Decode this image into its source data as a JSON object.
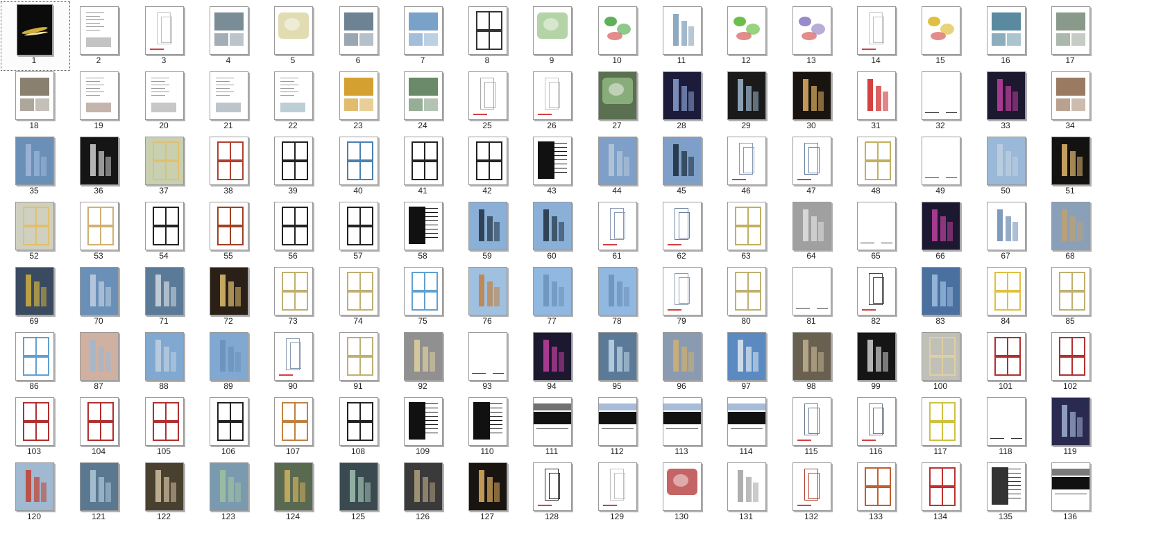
{
  "window": {
    "title": ""
  },
  "pages": [
    {
      "n": "1",
      "kind": "cover",
      "bg": "#0b0b0b",
      "accent": "#e8c040",
      "selected": true
    },
    {
      "n": "2",
      "kind": "text",
      "bg": "#ffffff"
    },
    {
      "n": "3",
      "kind": "sketch",
      "bg": "#ffffff",
      "accent": "#bfbfbf"
    },
    {
      "n": "4",
      "kind": "photo",
      "bg": "#ffffff",
      "accent": "#7a8c96"
    },
    {
      "n": "5",
      "kind": "map",
      "bg": "#ffffff",
      "accent": "#d8d09a"
    },
    {
      "n": "6",
      "kind": "photo",
      "bg": "#ffffff",
      "accent": "#6d8293"
    },
    {
      "n": "7",
      "kind": "photo",
      "bg": "#ffffff",
      "accent": "#7aa2c8"
    },
    {
      "n": "8",
      "kind": "plan",
      "bg": "#ffffff",
      "accent": "#333333"
    },
    {
      "n": "9",
      "kind": "map",
      "bg": "#ffffff",
      "accent": "#9bc48a"
    },
    {
      "n": "10",
      "kind": "diagram",
      "bg": "#ffffff",
      "accent": "#5fb05a"
    },
    {
      "n": "11",
      "kind": "render",
      "bg": "#ffffff",
      "accent": "#7a9ab5"
    },
    {
      "n": "12",
      "kind": "diagram",
      "bg": "#ffffff",
      "accent": "#6cc04a"
    },
    {
      "n": "13",
      "kind": "diagram",
      "bg": "#ffffff",
      "accent": "#9a8ac8"
    },
    {
      "n": "14",
      "kind": "sketch",
      "bg": "#ffffff",
      "accent": "#bfbfbf"
    },
    {
      "n": "15",
      "kind": "diagram",
      "bg": "#ffffff",
      "accent": "#e0c040"
    },
    {
      "n": "16",
      "kind": "photo",
      "bg": "#ffffff",
      "accent": "#5a8aa0"
    },
    {
      "n": "17",
      "kind": "photo",
      "bg": "#ffffff",
      "accent": "#8a9a8a"
    },
    {
      "n": "18",
      "kind": "photo",
      "bg": "#ffffff",
      "accent": "#8a8070"
    },
    {
      "n": "19",
      "kind": "text",
      "bg": "#ffffff",
      "accent": "#8a6a5a"
    },
    {
      "n": "20",
      "kind": "text",
      "bg": "#ffffff",
      "accent": "#909090"
    },
    {
      "n": "21",
      "kind": "text",
      "bg": "#ffffff",
      "accent": "#7a8a9a"
    },
    {
      "n": "22",
      "kind": "text",
      "bg": "#ffffff",
      "accent": "#7aa0b0"
    },
    {
      "n": "23",
      "kind": "photo",
      "bg": "#ffffff",
      "accent": "#d4a030"
    },
    {
      "n": "24",
      "kind": "photo",
      "bg": "#ffffff",
      "accent": "#6a8a6a"
    },
    {
      "n": "25",
      "kind": "sketch",
      "bg": "#ffffff",
      "accent": "#aaaaaa"
    },
    {
      "n": "26",
      "kind": "sketch",
      "bg": "#ffffff",
      "accent": "#bfbfbf"
    },
    {
      "n": "27",
      "kind": "map",
      "bg": "#5a7050",
      "accent": "#9ac08a"
    },
    {
      "n": "28",
      "kind": "render",
      "bg": "#1c1c3a",
      "accent": "#8aa0d0"
    },
    {
      "n": "29",
      "kind": "render",
      "bg": "#1a1a1a",
      "accent": "#a0b8d0"
    },
    {
      "n": "30",
      "kind": "render",
      "bg": "#1a1410",
      "accent": "#e0b060"
    },
    {
      "n": "31",
      "kind": "render",
      "bg": "#ffffff",
      "accent": "#cc2020"
    },
    {
      "n": "32",
      "kind": "blank",
      "bg": "#ffffff"
    },
    {
      "n": "33",
      "kind": "render",
      "bg": "#1c1830",
      "accent": "#c040a0"
    },
    {
      "n": "34",
      "kind": "photo",
      "bg": "#ffffff",
      "accent": "#9a7a60"
    },
    {
      "n": "35",
      "kind": "render",
      "bg": "#6a90b8",
      "accent": "#a0b8d8"
    },
    {
      "n": "36",
      "kind": "render",
      "bg": "#151515",
      "accent": "#d0d0d0"
    },
    {
      "n": "37",
      "kind": "plan",
      "bg": "#c8d0b0",
      "accent": "#e0c070"
    },
    {
      "n": "38",
      "kind": "plan",
      "bg": "#ffffff",
      "accent": "#b04030"
    },
    {
      "n": "39",
      "kind": "plan",
      "bg": "#ffffff",
      "accent": "#222222"
    },
    {
      "n": "40",
      "kind": "plan",
      "bg": "#ffffff",
      "accent": "#4a80b0"
    },
    {
      "n": "41",
      "kind": "plan",
      "bg": "#ffffff",
      "accent": "#222222"
    },
    {
      "n": "42",
      "kind": "plan",
      "bg": "#ffffff",
      "accent": "#222222"
    },
    {
      "n": "43",
      "kind": "section",
      "bg": "#ffffff",
      "accent": "#111111"
    },
    {
      "n": "44",
      "kind": "render",
      "bg": "#7ea0c8",
      "accent": "#b8c8d8"
    },
    {
      "n": "45",
      "kind": "render",
      "bg": "#7ea0c8",
      "accent": "#1a2a3a"
    },
    {
      "n": "46",
      "kind": "sketch",
      "bg": "#ffffff",
      "accent": "#8a9ab0"
    },
    {
      "n": "47",
      "kind": "sketch",
      "bg": "#ffffff",
      "accent": "#6a80a0"
    },
    {
      "n": "48",
      "kind": "plan",
      "bg": "#ffffff",
      "accent": "#c0b060"
    },
    {
      "n": "49",
      "kind": "blank",
      "bg": "#ffffff"
    },
    {
      "n": "50",
      "kind": "render",
      "bg": "#9ab8d8",
      "accent": "#c0d0e0"
    },
    {
      "n": "51",
      "kind": "render",
      "bg": "#141210",
      "accent": "#e0b870"
    },
    {
      "n": "52",
      "kind": "plan",
      "bg": "#d0d0c0",
      "accent": "#e0c070"
    },
    {
      "n": "53",
      "kind": "plan",
      "bg": "#ffffff",
      "accent": "#d0b070"
    },
    {
      "n": "54",
      "kind": "plan",
      "bg": "#ffffff",
      "accent": "#222222"
    },
    {
      "n": "55",
      "kind": "plan",
      "bg": "#ffffff",
      "accent": "#a04020"
    },
    {
      "n": "56",
      "kind": "plan",
      "bg": "#ffffff",
      "accent": "#222222"
    },
    {
      "n": "57",
      "kind": "plan",
      "bg": "#ffffff",
      "accent": "#222222"
    },
    {
      "n": "58",
      "kind": "section",
      "bg": "#ffffff",
      "accent": "#111111"
    },
    {
      "n": "59",
      "kind": "render",
      "bg": "#8ab0d8",
      "accent": "#203040"
    },
    {
      "n": "60",
      "kind": "render",
      "bg": "#8ab0d8",
      "accent": "#203040"
    },
    {
      "n": "61",
      "kind": "sketch",
      "bg": "#ffffff",
      "accent": "#8a9ab0"
    },
    {
      "n": "62",
      "kind": "sketch",
      "bg": "#ffffff",
      "accent": "#6a80a0"
    },
    {
      "n": "63",
      "kind": "plan",
      "bg": "#ffffff",
      "accent": "#c0b060"
    },
    {
      "n": "64",
      "kind": "render",
      "bg": "#a0a0a0",
      "accent": "#e0e0e0"
    },
    {
      "n": "65",
      "kind": "blank",
      "bg": "#ffffff"
    },
    {
      "n": "66",
      "kind": "render",
      "bg": "#1c1830",
      "accent": "#c040a0"
    },
    {
      "n": "67",
      "kind": "render",
      "bg": "#ffffff",
      "accent": "#6a8ab0"
    },
    {
      "n": "68",
      "kind": "render",
      "bg": "#8aa0b8",
      "accent": "#c0a070"
    },
    {
      "n": "69",
      "kind": "render",
      "bg": "#3a4a60",
      "accent": "#d0b040"
    },
    {
      "n": "70",
      "kind": "render",
      "bg": "#6a90b8",
      "accent": "#c0d0e0"
    },
    {
      "n": "71",
      "kind": "render",
      "bg": "#5a7a98",
      "accent": "#d0d8e0"
    },
    {
      "n": "72",
      "kind": "render",
      "bg": "#2a2018",
      "accent": "#e0c070"
    },
    {
      "n": "73",
      "kind": "plan",
      "bg": "#ffffff",
      "accent": "#c0b070"
    },
    {
      "n": "74",
      "kind": "plan",
      "bg": "#ffffff",
      "accent": "#c0b070"
    },
    {
      "n": "75",
      "kind": "plan",
      "bg": "#ffffff",
      "accent": "#60a0d0"
    },
    {
      "n": "76",
      "kind": "render",
      "bg": "#a0c0e0",
      "accent": "#c08040"
    },
    {
      "n": "77",
      "kind": "render",
      "bg": "#90b8e0",
      "accent": "#6a90b8"
    },
    {
      "n": "78",
      "kind": "render",
      "bg": "#90b8e0",
      "accent": "#6a90b8"
    },
    {
      "n": "79",
      "kind": "sketch",
      "bg": "#ffffff",
      "accent": "#8a9ab0"
    },
    {
      "n": "80",
      "kind": "plan",
      "bg": "#ffffff",
      "accent": "#c0b070"
    },
    {
      "n": "81",
      "kind": "blank",
      "bg": "#ffffff"
    },
    {
      "n": "82",
      "kind": "sketch",
      "bg": "#ffffff",
      "accent": "#444444"
    },
    {
      "n": "83",
      "kind": "render",
      "bg": "#4a70a0",
      "accent": "#a0c0e0"
    },
    {
      "n": "84",
      "kind": "plan",
      "bg": "#ffffff",
      "accent": "#e0c040"
    },
    {
      "n": "85",
      "kind": "plan",
      "bg": "#ffffff",
      "accent": "#c0b070"
    },
    {
      "n": "86",
      "kind": "plan",
      "bg": "#ffffff",
      "accent": "#60a0d0"
    },
    {
      "n": "87",
      "kind": "render",
      "bg": "#d0b0a0",
      "accent": "#a0b8d0"
    },
    {
      "n": "88",
      "kind": "render",
      "bg": "#80a8d0",
      "accent": "#c0d0e0"
    },
    {
      "n": "89",
      "kind": "render",
      "bg": "#80a8d0",
      "accent": "#6a90b8"
    },
    {
      "n": "90",
      "kind": "sketch",
      "bg": "#ffffff",
      "accent": "#8a9ab0"
    },
    {
      "n": "91",
      "kind": "plan",
      "bg": "#ffffff",
      "accent": "#c0b070"
    },
    {
      "n": "92",
      "kind": "render",
      "bg": "#909090",
      "accent": "#e0d0a0"
    },
    {
      "n": "93",
      "kind": "blank",
      "bg": "#ffffff"
    },
    {
      "n": "94",
      "kind": "render",
      "bg": "#1c1830",
      "accent": "#c040a0"
    },
    {
      "n": "95",
      "kind": "render",
      "bg": "#5a7a98",
      "accent": "#c0d8e8"
    },
    {
      "n": "96",
      "kind": "render",
      "bg": "#8a9ab0",
      "accent": "#d0b070"
    },
    {
      "n": "97",
      "kind": "render",
      "bg": "#5a8ac0",
      "accent": "#e0e8f0"
    },
    {
      "n": "98",
      "kind": "render",
      "bg": "#6a6050",
      "accent": "#c0b090"
    },
    {
      "n": "99",
      "kind": "render",
      "bg": "#151515",
      "accent": "#d0d0d0"
    },
    {
      "n": "100",
      "kind": "plan",
      "bg": "#c0c0b8",
      "accent": "#e0d0a0"
    },
    {
      "n": "101",
      "kind": "plan",
      "bg": "#ffffff",
      "accent": "#b03030"
    },
    {
      "n": "102",
      "kind": "plan",
      "bg": "#ffffff",
      "accent": "#b03030"
    },
    {
      "n": "103",
      "kind": "plan",
      "bg": "#ffffff",
      "accent": "#b03030"
    },
    {
      "n": "104",
      "kind": "plan",
      "bg": "#ffffff",
      "accent": "#b03030"
    },
    {
      "n": "105",
      "kind": "plan",
      "bg": "#ffffff",
      "accent": "#b03030"
    },
    {
      "n": "106",
      "kind": "plan",
      "bg": "#ffffff",
      "accent": "#222222"
    },
    {
      "n": "107",
      "kind": "plan",
      "bg": "#ffffff",
      "accent": "#c08040"
    },
    {
      "n": "108",
      "kind": "plan",
      "bg": "#ffffff",
      "accent": "#222222"
    },
    {
      "n": "109",
      "kind": "section",
      "bg": "#ffffff",
      "accent": "#111111"
    },
    {
      "n": "110",
      "kind": "section",
      "bg": "#ffffff",
      "accent": "#111111"
    },
    {
      "n": "111",
      "kind": "elevation",
      "bg": "#ffffff",
      "accent": "#111111"
    },
    {
      "n": "112",
      "kind": "elevation",
      "bg": "#ffffff",
      "accent": "#6a90c0"
    },
    {
      "n": "113",
      "kind": "elevation",
      "bg": "#ffffff",
      "accent": "#6a90c0"
    },
    {
      "n": "114",
      "kind": "elevation",
      "bg": "#ffffff",
      "accent": "#6a90c0"
    },
    {
      "n": "115",
      "kind": "sketch",
      "bg": "#ffffff",
      "accent": "#6a7a8a"
    },
    {
      "n": "116",
      "kind": "sketch",
      "bg": "#ffffff",
      "accent": "#6a7a8a"
    },
    {
      "n": "117",
      "kind": "plan",
      "bg": "#ffffff",
      "accent": "#d0c040"
    },
    {
      "n": "118",
      "kind": "blank",
      "bg": "#ffffff"
    },
    {
      "n": "119",
      "kind": "render",
      "bg": "#2a2a50",
      "accent": "#a0b0d0"
    },
    {
      "n": "120",
      "kind": "render",
      "bg": "#a0b8d0",
      "accent": "#c04030"
    },
    {
      "n": "121",
      "kind": "render",
      "bg": "#5a7890",
      "accent": "#b0c8d8"
    },
    {
      "n": "122",
      "kind": "render",
      "bg": "#4a4030",
      "accent": "#d0c0a0"
    },
    {
      "n": "123",
      "kind": "render",
      "bg": "#7a9ab0",
      "accent": "#a0c0a0"
    },
    {
      "n": "124",
      "kind": "render",
      "bg": "#5a6a50",
      "accent": "#d0b060"
    },
    {
      "n": "125",
      "kind": "render",
      "bg": "#3a4a50",
      "accent": "#a0c0b0"
    },
    {
      "n": "126",
      "kind": "render",
      "bg": "#3a3a3a",
      "accent": "#b0a080"
    },
    {
      "n": "127",
      "kind": "render",
      "bg": "#1a1410",
      "accent": "#e0b060"
    },
    {
      "n": "128",
      "kind": "sketch",
      "bg": "#ffffff",
      "accent": "#222222"
    },
    {
      "n": "129",
      "kind": "sketch",
      "bg": "#ffffff",
      "accent": "#bfbfbf"
    },
    {
      "n": "130",
      "kind": "map",
      "bg": "#ffffff",
      "accent": "#b03030"
    },
    {
      "n": "131",
      "kind": "render",
      "bg": "#ffffff",
      "accent": "#a0a0a0"
    },
    {
      "n": "132",
      "kind": "sketch",
      "bg": "#ffffff",
      "accent": "#b04030"
    },
    {
      "n": "133",
      "kind": "plan",
      "bg": "#ffffff",
      "accent": "#c06030"
    },
    {
      "n": "134",
      "kind": "plan",
      "bg": "#ffffff",
      "accent": "#c03030"
    },
    {
      "n": "135",
      "kind": "section",
      "bg": "#ffffff",
      "accent": "#333333"
    },
    {
      "n": "136",
      "kind": "elevation",
      "bg": "#ffffff",
      "accent": "#222222"
    }
  ]
}
